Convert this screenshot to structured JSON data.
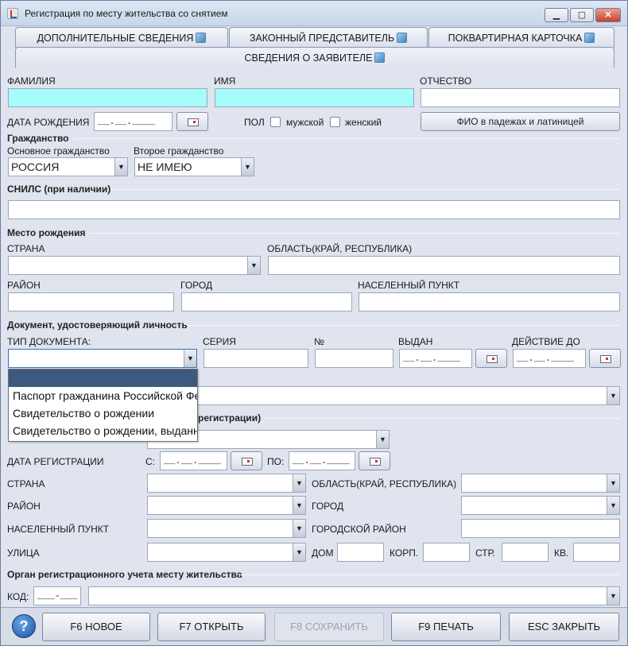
{
  "window": {
    "title": "Регистрация по месту жительства со снятием",
    "minimize": "▁",
    "maximize": "▢",
    "close": "✕"
  },
  "tabs": [
    {
      "label": "ДОПОЛНИТЕЛЬНЫЕ СВЕДЕНИЯ"
    },
    {
      "label": "ЗАКОННЫЙ ПРЕДСТАВИТЕЛЬ"
    },
    {
      "label": "ПОКВАРТИРНАЯ КАРТОЧКА"
    },
    {
      "label": "СВЕДЕНИЯ О ЗАЯВИТЕЛЕ"
    }
  ],
  "applicant": {
    "surname_label": "ФАМИЛИЯ",
    "name_label": "ИМЯ",
    "patronymic_label": "ОТЧЕСТВО",
    "birthdate_label": "ДАТА РОЖДЕНИЯ",
    "birthdate_value": "__.__.____",
    "sex_label": "ПОЛ",
    "male_label": "мужской",
    "female_label": "женский",
    "fio_button": "ФИО в падежах и латиницей"
  },
  "citizenship": {
    "section_title": "Гражданство",
    "main_label": "Основное гражданство",
    "main_value": "РОССИЯ",
    "second_label": "Второе гражданство",
    "second_value": "НЕ ИМЕЮ"
  },
  "snils": {
    "section_title": "СНИЛС (при наличии)"
  },
  "birthplace": {
    "section_title": "Место рождения",
    "country_label": "СТРАНА",
    "region_label": "ОБЛАСТЬ(КРАЙ, РЕСПУБЛИКА)",
    "district_label": "РАЙОН",
    "city_label": "ГОРОД",
    "settlement_label": "НАСЕЛЕННЫЙ ПУНКТ"
  },
  "identity_doc": {
    "section_title": "Документ, удостоверяющий личность",
    "type_label": "ТИП ДОКУМЕНТА:",
    "series_label": "СЕРИЯ",
    "number_label": "№",
    "issued_label": "ВЫДАН",
    "issued_value": "__.__.____",
    "valid_label": "ДЕЙСТВИЕ ДО",
    "valid_value": "__.__.____",
    "dropdown_options": [
      "",
      "Паспорт гражданина Российской Федерации",
      "Свидетельство о рождении",
      "Свидетельство о рождении, выданное"
    ]
  },
  "registration": {
    "section_title_partial": "регистрации)",
    "date_label": "ДАТА РЕГИСТРАЦИИ",
    "from_label": "С:",
    "from_value": "__.__.____",
    "to_label": "ПО:",
    "to_value": "__.__.____",
    "country_label": "СТРАНА",
    "region_label": "ОБЛАСТЬ(КРАЙ, РЕСПУБЛИКА)",
    "district_label": "РАЙОН",
    "city_label": "ГОРОД",
    "settlement_label": "НАСЕЛЕННЫЙ ПУНКТ",
    "city_district_label": "ГОРОДСКОЙ РАЙОН",
    "street_label": "УЛИЦА",
    "house_label": "ДОМ",
    "building_label": "КОРП.",
    "structure_label": "СТР.",
    "flat_label": "КВ."
  },
  "authority": {
    "section_title": "Орган регистрационного учета месту жительства",
    "code_label": "КОД:",
    "code_value": "___-___"
  },
  "footer": {
    "help": "?",
    "new": "F6  НОВОЕ",
    "open": "F7  ОТКРЫТЬ",
    "save": "F8  СОХРАНИТЬ",
    "print": "F9  ПЕЧАТЬ",
    "close": "ESC  ЗАКРЫТЬ"
  },
  "arrow_glyph": "▼"
}
